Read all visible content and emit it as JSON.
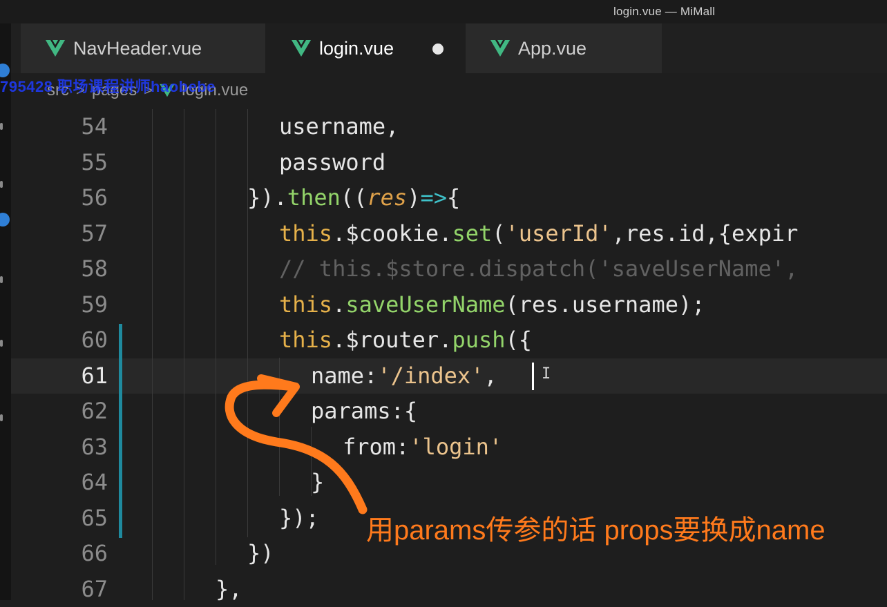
{
  "window": {
    "title": "login.vue — MiMall"
  },
  "tabs": [
    {
      "label": "NavHeader.vue",
      "icon": "vue-icon",
      "active": false
    },
    {
      "label": "login.vue",
      "icon": "vue-icon",
      "active": true,
      "unsaved": true
    },
    {
      "label": "App.vue",
      "icon": "vue-icon",
      "active": false
    }
  ],
  "breadcrumb": {
    "items": [
      "src",
      "pages",
      "login.vue"
    ],
    "separator": ">"
  },
  "watermark": {
    "text": "795428 职场课程讲师haobebe"
  },
  "editor": {
    "current_line": 61,
    "lines": [
      {
        "num": "54",
        "tokens": [
          {
            "t": "username,",
            "c": "plain"
          }
        ]
      },
      {
        "num": "55",
        "tokens": [
          {
            "t": "password",
            "c": "plain"
          }
        ]
      },
      {
        "num": "56",
        "tokens": [
          {
            "t": "}).",
            "c": "plain"
          },
          {
            "t": "then",
            "c": "fn"
          },
          {
            "t": "((",
            "c": "plain"
          },
          {
            "t": "res",
            "c": "param"
          },
          {
            "t": ")",
            "c": "plain"
          },
          {
            "t": "=>",
            "c": "arrow"
          },
          {
            "t": "{",
            "c": "plain"
          }
        ]
      },
      {
        "num": "57",
        "tokens": [
          {
            "t": "this",
            "c": "kw-this"
          },
          {
            "t": ".$cookie.",
            "c": "plain"
          },
          {
            "t": "set",
            "c": "fn"
          },
          {
            "t": "(",
            "c": "plain"
          },
          {
            "t": "'userId'",
            "c": "str"
          },
          {
            "t": ",res.id,{expir",
            "c": "plain"
          }
        ]
      },
      {
        "num": "58",
        "tokens": [
          {
            "t": "// this.$store.dispatch('saveUserName',",
            "c": "comment"
          }
        ]
      },
      {
        "num": "59",
        "tokens": [
          {
            "t": "this",
            "c": "kw-this"
          },
          {
            "t": ".",
            "c": "plain"
          },
          {
            "t": "saveUserName",
            "c": "fn"
          },
          {
            "t": "(res.username);",
            "c": "plain"
          }
        ]
      },
      {
        "num": "60",
        "tokens": [
          {
            "t": "this",
            "c": "kw-this"
          },
          {
            "t": ".$router.",
            "c": "plain"
          },
          {
            "t": "push",
            "c": "fn"
          },
          {
            "t": "({",
            "c": "plain"
          }
        ]
      },
      {
        "num": "61",
        "tokens": [
          {
            "t": "name:",
            "c": "plain"
          },
          {
            "t": "'/index'",
            "c": "str"
          },
          {
            "t": ",",
            "c": "plain"
          }
        ]
      },
      {
        "num": "62",
        "tokens": [
          {
            "t": "params:{",
            "c": "plain"
          }
        ]
      },
      {
        "num": "63",
        "tokens": [
          {
            "t": "from:",
            "c": "plain"
          },
          {
            "t": "'login'",
            "c": "str"
          }
        ]
      },
      {
        "num": "64",
        "tokens": [
          {
            "t": "}",
            "c": "plain"
          }
        ]
      },
      {
        "num": "65",
        "tokens": [
          {
            "t": "});",
            "c": "plain"
          }
        ]
      },
      {
        "num": "66",
        "tokens": [
          {
            "t": "})",
            "c": "plain"
          }
        ]
      },
      {
        "num": "67",
        "tokens": [
          {
            "t": "},",
            "c": "plain"
          }
        ]
      }
    ]
  },
  "annotation": {
    "text": "用params传参的话 props要换成name",
    "color": "#ff7a1c"
  },
  "colors": {
    "accent_modified": "#1f8a9e",
    "vue_green": "#41b883"
  }
}
